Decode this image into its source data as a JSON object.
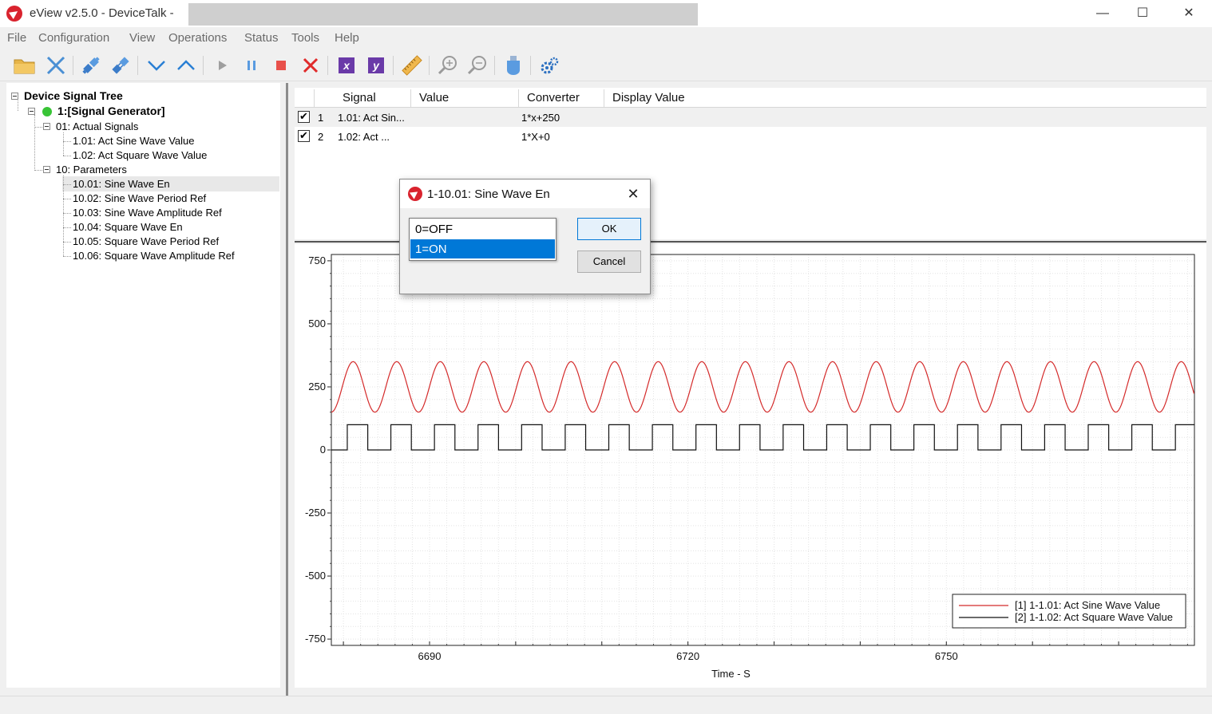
{
  "window": {
    "title": "eView v2.5.0 - DeviceTalk -",
    "controls": {
      "minimize": "—",
      "maximize": "☐",
      "close": "✕"
    }
  },
  "menu": [
    "File",
    "Configuration",
    "View",
    "Operations",
    "Status",
    "Tools",
    "Help"
  ],
  "toolbar": {
    "icons": [
      "open-folder-icon",
      "disconnect-icon",
      "connect-icon",
      "plug-icon",
      "move-down-icon",
      "move-up-icon",
      "play-icon",
      "pause-icon",
      "stop-icon",
      "delete-icon",
      "x-axis-icon",
      "y-axis-icon",
      "ruler-icon",
      "zoom-in-icon",
      "zoom-out-icon",
      "usb-icon",
      "settings-icon"
    ],
    "x_label": "x",
    "y_label": "y"
  },
  "tree": {
    "title": "Device Signal Tree",
    "device": "1:[Signal Generator]",
    "device_status_color": "#38c436",
    "groups": [
      {
        "label": "01: Actual Signals",
        "items": [
          "1.01: Act Sine Wave Value",
          "1.02: Act Square Wave Value"
        ]
      },
      {
        "label": "10: Parameters",
        "items": [
          "10.01: Sine Wave En",
          "10.02: Sine Wave Period Ref",
          "10.03: Sine Wave Amplitude Ref",
          "10.04: Square Wave En",
          "10.05: Square Wave Period Ref",
          "10.06: Square Wave Amplitude Ref"
        ]
      }
    ],
    "selected_item": "10.01: Sine Wave En"
  },
  "table": {
    "headers": [
      "Signal",
      "Value",
      "Converter",
      "Display Value"
    ],
    "rows": [
      {
        "checked": true,
        "check_mark": "✔",
        "index": "1",
        "signal": "1.01: Act Sin...",
        "value": "",
        "converter": "1*x+250",
        "display_value": ""
      },
      {
        "checked": true,
        "check_mark": "✔",
        "index": "2",
        "signal": "1.02: Act ...",
        "value": "",
        "converter": "1*X+0",
        "display_value": ""
      }
    ]
  },
  "dialog": {
    "title": "1-10.01: Sine Wave En",
    "close_label": "✕",
    "options": [
      "0=OFF",
      "1=ON"
    ],
    "selected_option": "1=ON",
    "ok_label": "OK",
    "cancel_label": "Cancel"
  },
  "chart_data": {
    "type": "line",
    "xlabel": "Time - S",
    "ylabel": "",
    "xlim": [
      6678.6,
      6778.8
    ],
    "ylim": [
      -775,
      775
    ],
    "x_ticks": [
      6690,
      6720,
      6750
    ],
    "y_ticks": [
      750,
      500,
      250,
      0,
      -250,
      -500,
      -750
    ],
    "grid": true,
    "legend_position": "bottom-right",
    "series": [
      {
        "name": "[1] 1-1.01: Act Sine Wave Value",
        "color": "#d42a2a",
        "form": "sine",
        "offset": 250,
        "amplitude": 100,
        "period": 5.06,
        "phase_start": 6678.6,
        "value_at_start": 150
      },
      {
        "name": "[2] 1-1.02: Act Square Wave Value",
        "color": "#111111",
        "form": "square",
        "high": 100,
        "low": 0,
        "period": 5.06,
        "duty": 0.47,
        "first_rise": 6680.45
      }
    ]
  }
}
